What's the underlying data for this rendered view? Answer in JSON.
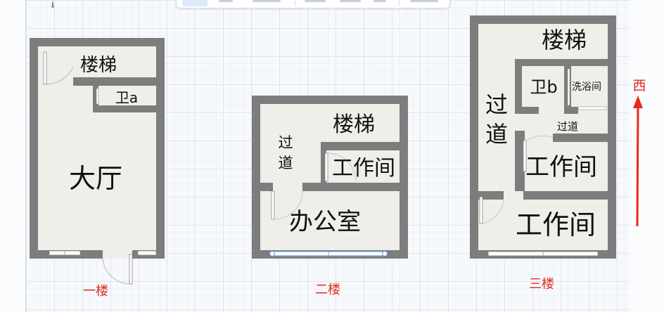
{
  "canvas": {
    "direction_label": "西",
    "direction_color": "#e8291c",
    "caption_color": "#e02a1f",
    "wall_color": "#7d7d7d",
    "floor_color": "#efeee9"
  },
  "floors": [
    {
      "caption": "一楼",
      "rooms": [
        {
          "label": "楼梯"
        },
        {
          "label": "卫a"
        },
        {
          "label": "大厅"
        }
      ]
    },
    {
      "caption": "二楼",
      "rooms": [
        {
          "label": "楼梯"
        },
        {
          "label": "过"
        },
        {
          "label": "道"
        },
        {
          "label": "工作间"
        },
        {
          "label": "办公室"
        }
      ]
    },
    {
      "caption": "三楼",
      "rooms": [
        {
          "label": "楼梯"
        },
        {
          "label": "卫b"
        },
        {
          "label": "洗浴间"
        },
        {
          "label": "过"
        },
        {
          "label": "道"
        },
        {
          "label": "过道"
        },
        {
          "label": "工作间"
        },
        {
          "label": "工作间"
        }
      ]
    }
  ]
}
